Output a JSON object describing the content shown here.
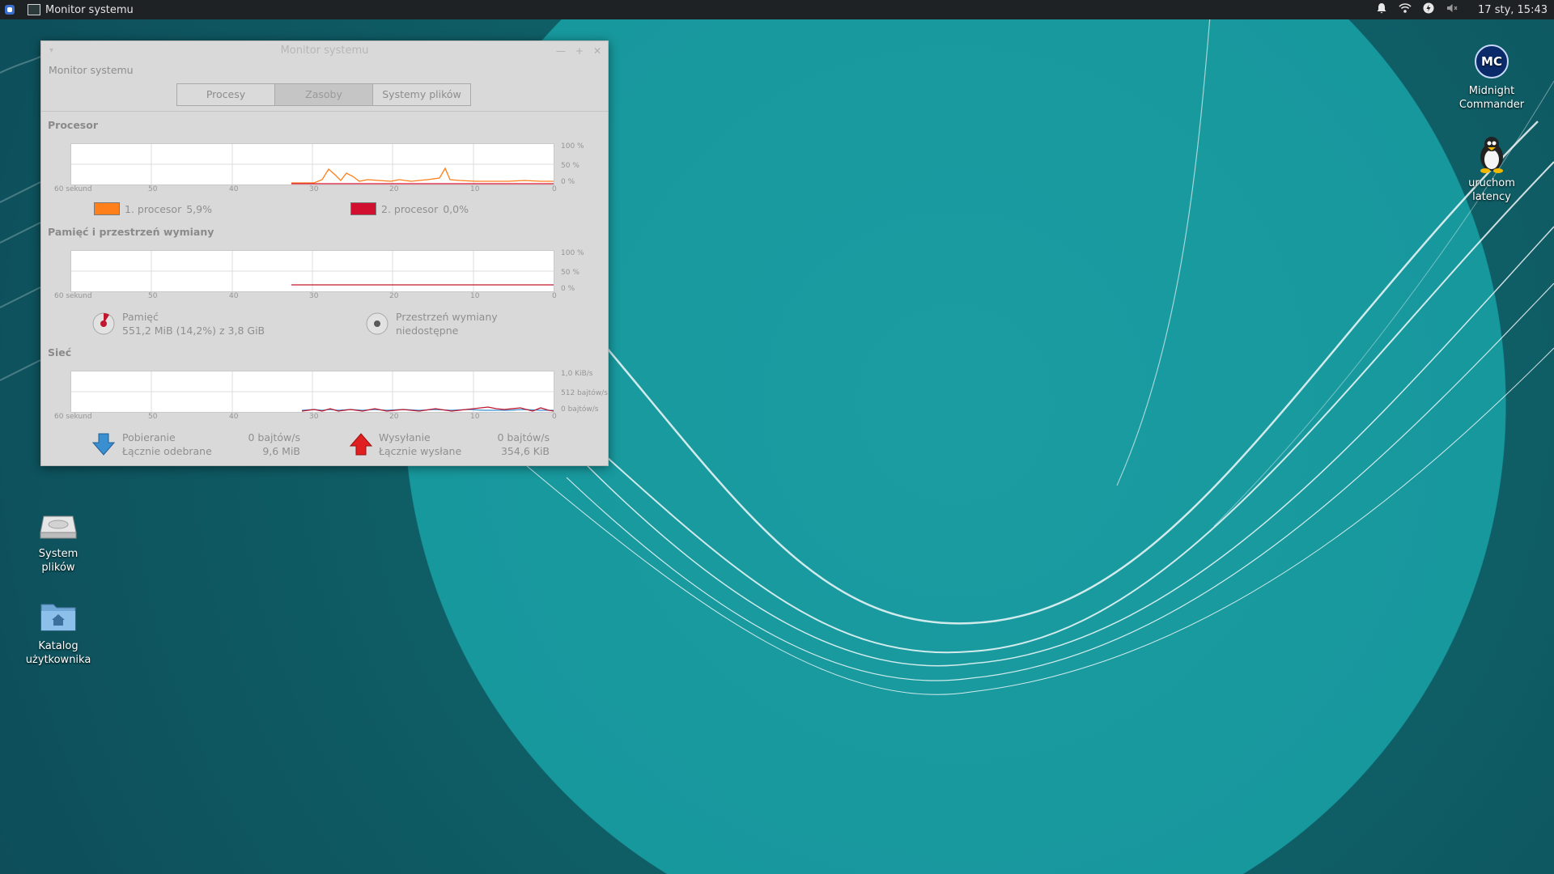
{
  "panel": {
    "task_title": "Monitor systemu",
    "clock": "17 sty, 15:43"
  },
  "desktop": {
    "icons": [
      {
        "label": "Midnight Commander",
        "icon": "midnight-commander-icon"
      },
      {
        "label": "uruchom latency",
        "icon": "tux-icon"
      },
      {
        "label": "System plików",
        "icon": "drive-icon"
      },
      {
        "label": "Katalog użytkownika",
        "icon": "home-folder-icon"
      }
    ]
  },
  "window": {
    "title": "Monitor systemu",
    "app_title": "Monitor systemu",
    "tabs": [
      {
        "label": "Procesy",
        "active": false
      },
      {
        "label": "Zasoby",
        "active": true
      },
      {
        "label": "Systemy plików",
        "active": false
      }
    ],
    "x_ticks": [
      "60 sekund",
      "50",
      "40",
      "30",
      "20",
      "10",
      "0"
    ],
    "cpu": {
      "heading": "Procesor",
      "y_ticks": [
        "100 %",
        "50 %",
        "0 %"
      ],
      "cpu1_label": "1. procesor",
      "cpu1_value": "5,9%",
      "cpu1_color": "#ff7f1a",
      "cpu2_label": "2. procesor",
      "cpu2_value": "0,0%",
      "cpu2_color": "#d0102e"
    },
    "memory": {
      "heading": "Pamięć i przestrzeń wymiany",
      "y_ticks": [
        "100 %",
        "50 %",
        "0 %"
      ],
      "mem_label": "Pamięć",
      "mem_value": "551,2 MiB (14,2%) z 3,8 GiB",
      "swap_label": "Przestrzeń wymiany",
      "swap_value": "niedostępne"
    },
    "network": {
      "heading": "Sieć",
      "y_ticks": [
        "1,0 KiB/s",
        "512 bajtów/s",
        "0 bajtów/s"
      ],
      "rx_label": "Pobieranie",
      "rx_value": "0 bajtów/s",
      "rx_total_label": "Łącznie odebrane",
      "rx_total_value": "9,6 MiB",
      "tx_label": "Wysyłanie",
      "tx_value": "0 bajtów/s",
      "tx_total_label": "Łącznie wysłane",
      "tx_total_value": "354,6 KiB"
    }
  },
  "colors": {
    "accent_orange": "#ff7f1a",
    "accent_red": "#d0102e",
    "rx_blue": "#3a8fd0",
    "tx_red": "#e02020"
  }
}
